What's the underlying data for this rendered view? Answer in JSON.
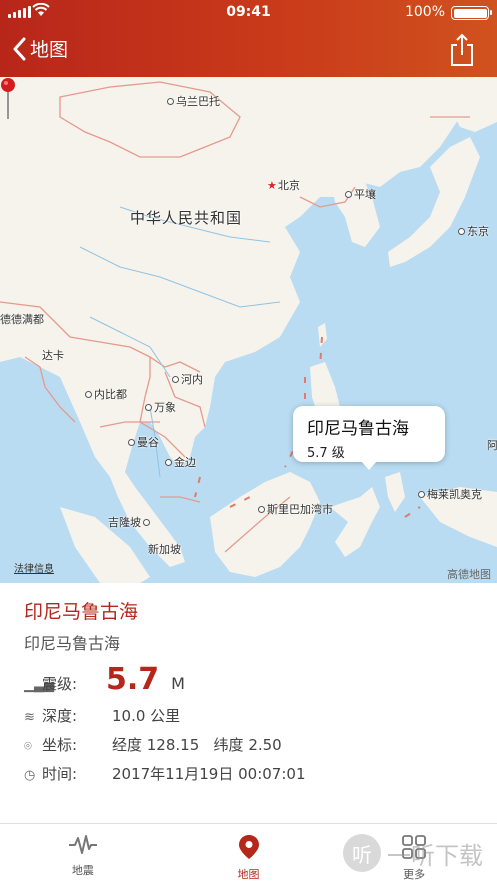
{
  "status_bar": {
    "time": "09:41",
    "battery_text": "100%"
  },
  "nav": {
    "back_label": "地图"
  },
  "map": {
    "labels": {
      "ulaanbaatar": "乌兰巴托",
      "beijing": "北京",
      "china": "中华人民共和国",
      "pyongyang": "平壤",
      "tokyo": "东京",
      "naypyidaw": "德德满都",
      "dhaka": "达卡",
      "naypyitaw": "内比都",
      "hanoi": "河内",
      "vientiane": "万象",
      "bangkok": "曼谷",
      "phnompenh": "金边",
      "kualalumpur": "吉隆坡",
      "singapore": "新加坡",
      "bandar": "斯里巴加湾市",
      "melekeok": "梅莱凯奥克",
      "edge_right": "阿"
    },
    "callout_title": "印尼马鲁古海",
    "callout_sub": "5.7 级",
    "legal": "法律信息",
    "logo": "高德地图"
  },
  "details": {
    "title": "印尼马鲁古海",
    "subtitle": "印尼马鲁古海",
    "magnitude_label": "震级:",
    "magnitude_value": "5.7",
    "magnitude_unit": "M",
    "depth_label": "深度:",
    "depth_value": "10.0 公里",
    "coord_label": "坐标:",
    "coord_value": "经度 128.15   纬度 2.50",
    "time_label": "时间:",
    "time_value": "2017年11月19日 00:07:01"
  },
  "tabs": [
    {
      "label": "地震",
      "icon": "waveform-icon",
      "active": false
    },
    {
      "label": "地图",
      "icon": "location-pin-icon",
      "active": true
    },
    {
      "label": "更多",
      "icon": "grid-icon",
      "active": false
    }
  ],
  "watermark": "一听下载",
  "colors": {
    "accent": "#b5271b",
    "map_water": "#b9dcf2",
    "map_land": "#f6f3ec"
  }
}
